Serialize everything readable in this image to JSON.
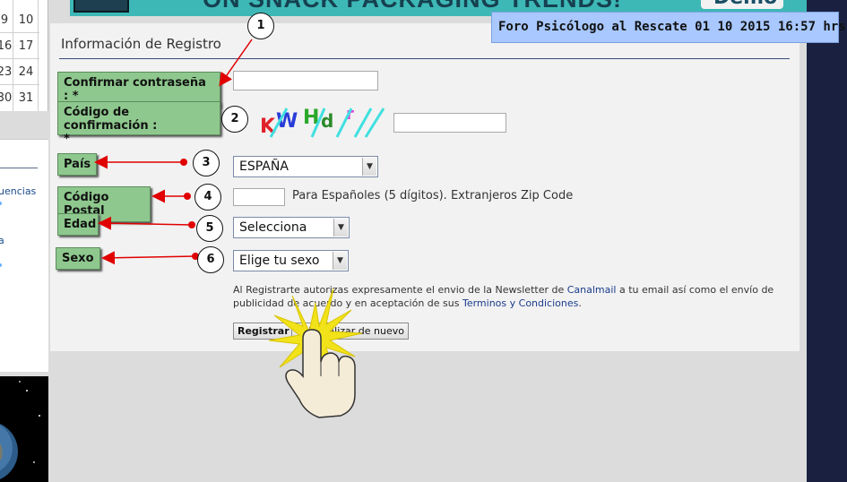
{
  "calendar": {
    "rows": [
      {
        "a": "9",
        "b": "10"
      },
      {
        "a": "16",
        "b": "17"
      },
      {
        "a": "23",
        "b": "24"
      },
      {
        "a": "30",
        "b": "31"
      }
    ]
  },
  "side_panel": {
    "links": [
      "uencias",
      "a"
    ]
  },
  "banner": {
    "headline": "ON SNACK PACKAGING TRENDS!",
    "cta": "Demo"
  },
  "date_badge": "Foro Psicólogo al Rescate 01 10 2015 16:57 hrs.",
  "form": {
    "title": "Información de Registro",
    "confirm_password": {
      "label": "Confirmar contraseña : *",
      "value": ""
    },
    "confirmation_code": {
      "label_line1": "Código de confirmación :",
      "label_line2": "*",
      "value": ""
    },
    "captcha": {
      "chars": [
        "K",
        "W",
        "H",
        "d",
        "r"
      ],
      "colors": [
        "#e0202a",
        "#2a3cd8",
        "#2aa82a",
        "#2a8a2a",
        "#e040e0"
      ]
    },
    "country": {
      "label": "País",
      "value": "ESPAÑA"
    },
    "postal_code": {
      "label": "Código Postal",
      "value": "",
      "hint": "Para Españoles (5 dígitos). Extranjeros Zip Code"
    },
    "age": {
      "label": "Edad",
      "value": "Selecciona"
    },
    "sex": {
      "label": "Sexo",
      "value": "Elige tu sexo"
    },
    "consent": {
      "before": "Al Registrarte autorizas expresamente el envio de la Newsletter de ",
      "link1": "Canalmail",
      "middle": " a tu email así como el envío de publicidad de acuerdo y en aceptación de sus ",
      "link2": "Terminos y Condiciones",
      "after": "."
    },
    "buttons": {
      "register": "Registrar",
      "reset": "Inicializar de nuevo"
    }
  },
  "annotations": {
    "numbers": [
      "1",
      "2",
      "3",
      "4",
      "5",
      "6"
    ],
    "arrow_color": "#e00000",
    "burst_color": "#f2e21a"
  }
}
